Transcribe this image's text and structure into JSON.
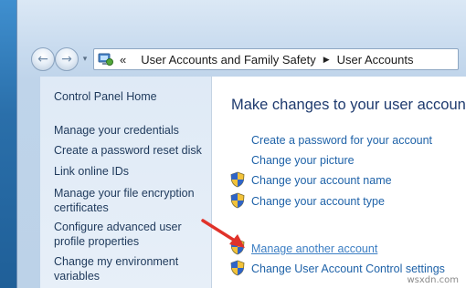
{
  "address_bar": {
    "crumbs": [
      "User Accounts and Family Safety",
      "User Accounts"
    ],
    "overflow_chevron": "«"
  },
  "left_pane": {
    "links": [
      "Control Panel Home",
      "Manage your credentials",
      "Create a password reset disk",
      "Link online IDs",
      "Manage your file encryption certificates",
      "Configure advanced user profile properties",
      "Change my environment variables"
    ]
  },
  "main": {
    "title": "Make changes to your user account",
    "tasks": [
      "Create a password for your account",
      "Change your picture",
      "Change your account name",
      "Change your account type",
      "Manage another account",
      "Change User Account Control settings"
    ]
  },
  "watermark": "wsxdn.com",
  "colors": {
    "link": "#1e62a8",
    "hover_link": "#3d7fc4",
    "left_link": "#1e395b",
    "title": "#1e3a6e",
    "arrow": "#e0322a"
  }
}
